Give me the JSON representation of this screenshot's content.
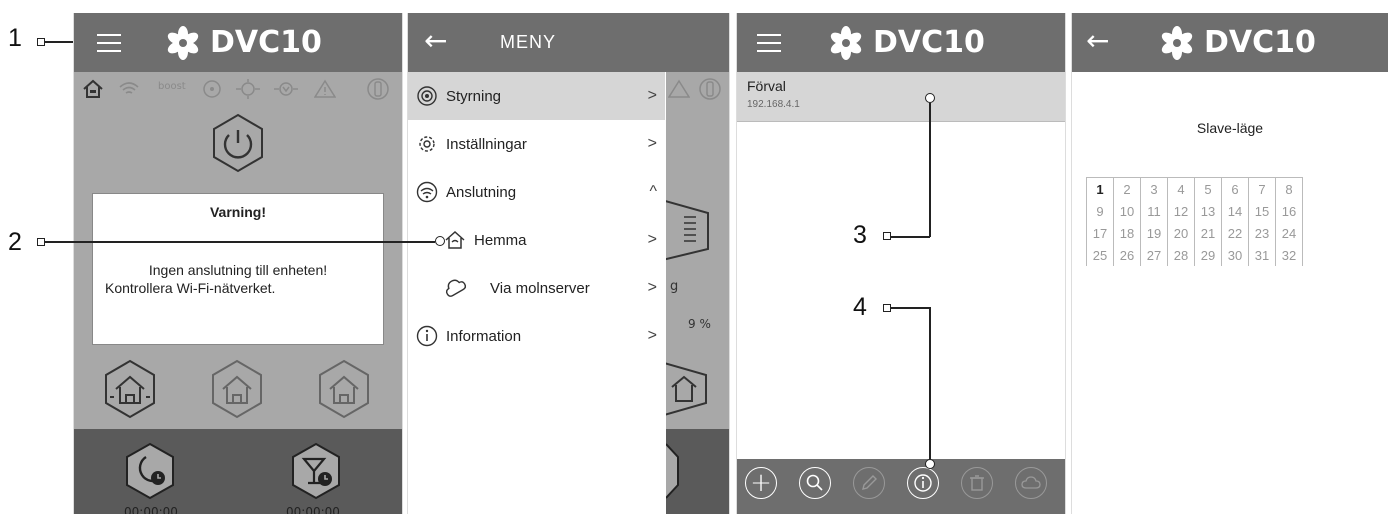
{
  "app": {
    "title": "DVC10"
  },
  "callouts": [
    {
      "n": "1"
    },
    {
      "n": "2"
    },
    {
      "n": "3"
    },
    {
      "n": "4"
    }
  ],
  "screen1": {
    "status_icons": [
      "home-icon",
      "wifi-icon",
      "boost-icon",
      "fan-icon",
      "heat-icon",
      "cool-icon",
      "warning-icon",
      "filter-icon"
    ],
    "boost_label": "boost",
    "warning": {
      "title": "Varning!",
      "line1": "Ingen anslutning till enheten!",
      "line2": "Kontrollera Wi-Fi-nätverket."
    },
    "timers": [
      "00:00:00",
      "00:00:00"
    ]
  },
  "screen2": {
    "header": "MENY",
    "items": [
      {
        "icon": "control-icon",
        "label": "Styrning",
        "chevron": ">"
      },
      {
        "icon": "settings-icon",
        "label": "Inställningar",
        "chevron": ">"
      },
      {
        "icon": "wifi-icon",
        "label": "Anslutning",
        "chevron": "^"
      },
      {
        "icon": "home-icon",
        "label": "Hemma",
        "chevron": ">"
      },
      {
        "icon": "cloud-icon",
        "label": "Via molnserver",
        "chevron": ">"
      },
      {
        "icon": "info-icon",
        "label": "Information",
        "chevron": ">"
      }
    ],
    "background_fragments": {
      "g": "g",
      "percent": "9 %"
    }
  },
  "screen3": {
    "device": {
      "name": "Förval",
      "ip": "192.168.4.1"
    },
    "toolbar": [
      "add-icon",
      "search-icon",
      "edit-icon",
      "info-icon",
      "delete-icon",
      "cloud-icon"
    ]
  },
  "screen4": {
    "title": "Slave-läge",
    "grid": [
      [
        "1",
        "2",
        "3",
        "4",
        "5",
        "6",
        "7",
        "8"
      ],
      [
        "9",
        "10",
        "11",
        "12",
        "13",
        "14",
        "15",
        "16"
      ],
      [
        "17",
        "18",
        "19",
        "20",
        "21",
        "22",
        "23",
        "24"
      ],
      [
        "25",
        "26",
        "27",
        "28",
        "29",
        "30",
        "31",
        "32"
      ]
    ],
    "selected": "1"
  },
  "colors": {
    "bar": "#6e6e6e",
    "overlay": "#a8a8a8",
    "highlight": "#d6d6d6",
    "bottom": "#5a5a5a"
  }
}
